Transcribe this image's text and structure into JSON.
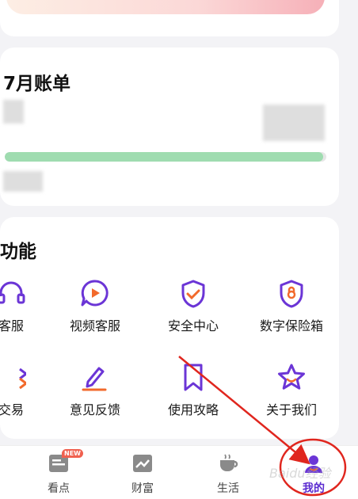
{
  "bill": {
    "title": "7月账单",
    "progress_fraction": 0.99
  },
  "functions": {
    "title": "功能",
    "row1": [
      {
        "label": "客服",
        "icon": "headset-icon"
      },
      {
        "label": "视频客服",
        "icon": "video-chat-icon"
      },
      {
        "label": "安全中心",
        "icon": "shield-check-icon"
      },
      {
        "label": "数字保险箱",
        "icon": "safe-lock-icon"
      }
    ],
    "row2": [
      {
        "label": "交易",
        "icon": "transaction-icon"
      },
      {
        "label": "意见反馈",
        "icon": "pen-feedback-icon"
      },
      {
        "label": "使用攻略",
        "icon": "bookmark-icon"
      },
      {
        "label": "关于我们",
        "icon": "star-smile-icon"
      }
    ]
  },
  "nav": {
    "items": [
      {
        "label": "看点",
        "icon": "news-icon",
        "badge": "NEW"
      },
      {
        "label": "财富",
        "icon": "trend-chart-icon"
      },
      {
        "label": "生活",
        "icon": "coffee-cup-icon"
      },
      {
        "label": "我的",
        "icon": "user-profile-icon",
        "active": true
      }
    ]
  },
  "colors": {
    "accent": "#6b35d6",
    "accent_orange": "#f26a2c",
    "progress": "#9fdcb0",
    "annotation": "#e0261e"
  },
  "watermark": "Baidu经验"
}
